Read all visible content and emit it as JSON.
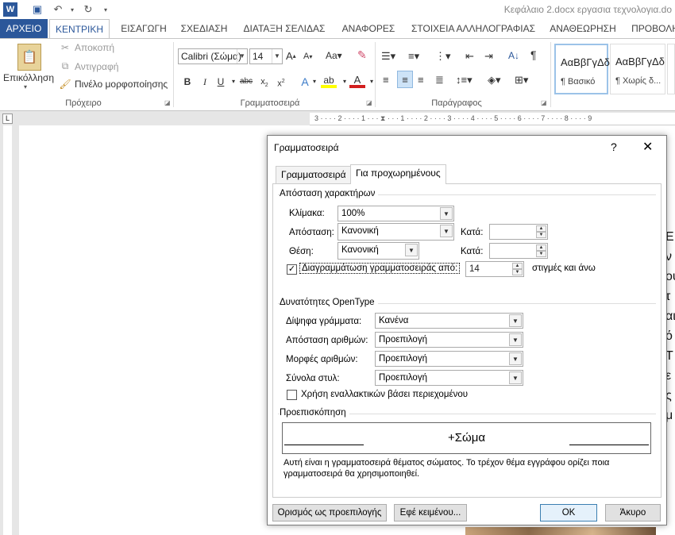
{
  "qat": {
    "title": "Κεφάλαιο 2.docx  εργασια τεχνολογια.do"
  },
  "tabs": [
    "ΑΡΧΕΙΟ",
    "ΚΕΝΤΡΙΚΗ",
    "ΕΙΣΑΓΩΓΗ",
    "ΣΧΕΔΙΑΣΗ",
    "ΔΙΑΤΑΞΗ ΣΕΛΙΔΑΣ",
    "ΑΝΑΦΟΡΕΣ",
    "ΣΤΟΙΧΕΙΑ ΑΛΛΗΛΟΓΡΑΦΙΑΣ",
    "ΑΝΑΘΕΩΡΗΣΗ",
    "ΠΡΟΒΟΛΗ"
  ],
  "ribbon": {
    "clipboard": {
      "paste": "Επικόλληση",
      "cut": "Αποκοπή",
      "copy": "Αντιγραφή",
      "painter": "Πινέλο μορφοποίησης",
      "label": "Πρόχειρο"
    },
    "font": {
      "name": "Calibri (Σώμα)",
      "size": "14",
      "label": "Γραμματοσειρά"
    },
    "paragraph": {
      "label": "Παράγραφος"
    },
    "styles": [
      {
        "sample": "ΑαΒβΓγΔδ",
        "name": "¶ Βασικό"
      },
      {
        "sample": "ΑαΒβΓγΔδ",
        "name": "¶ Χωρίς δ..."
      }
    ]
  },
  "doc": {
    "side_chars": [
      "Ε",
      "ν",
      "ου",
      "τ",
      "αι",
      "ό",
      "Τ",
      "ε",
      "ς",
      "μ"
    ]
  },
  "dialog": {
    "title": "Γραμματοσειρά",
    "help": "?",
    "tabs": [
      "Γραμματοσειρά",
      "Για προχωρημένους"
    ],
    "spacing": {
      "section": "Απόσταση χαρακτήρων",
      "scale_label": "Κλίμακα:",
      "scale_value": "100%",
      "spacing_label": "Απόσταση:",
      "spacing_value": "Κανονική",
      "by1_label": "Κατά:",
      "by1_value": "",
      "position_label": "Θέση:",
      "position_value": "Κανονική",
      "by2_label": "Κατά:",
      "by2_value": "",
      "kerning_label": "Διαγραμμάτωση γραμματοσειράς από:",
      "kerning_checked": true,
      "kerning_value": "14",
      "kerning_unit": "στιγμές και άνω"
    },
    "opentype": {
      "section": "Δυνατότητες OpenType",
      "ligatures_label": "Δίψηφα γράμματα:",
      "ligatures_value": "Κανένα",
      "num_spacing_label": "Απόσταση αριθμών:",
      "num_spacing_value": "Προεπιλογή",
      "num_forms_label": "Μορφές αριθμών:",
      "num_forms_value": "Προεπιλογή",
      "stylistic_label": "Σύνολα στυλ:",
      "stylistic_value": "Προεπιλογή",
      "contextual_label": "Χρήση εναλλακτικών βάσει περιεχομένου",
      "contextual_checked": false
    },
    "preview": {
      "section": "Προεπισκόπηση",
      "text": "+Σώμα",
      "description": "Αυτή είναι η γραμματοσειρά θέματος σώματος. Το τρέχον θέμα εγγράφου ορίζει ποια γραμματοσειρά θα χρησιμοποιηθεί."
    },
    "buttons": {
      "set_default": "Ορισμός ως προεπιλογής",
      "text_effects": "Εφέ κειμένου...",
      "ok": "OK",
      "cancel": "Άκυρο"
    }
  }
}
